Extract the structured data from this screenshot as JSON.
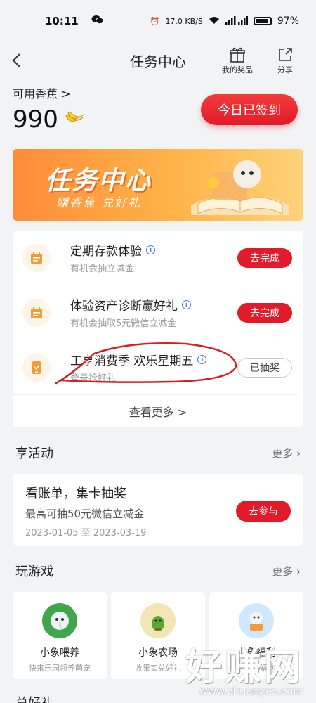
{
  "status_bar": {
    "time": "10:11",
    "speed": "17.0 KB/S",
    "battery": "97%"
  },
  "header": {
    "back_icon": "chevron-left-icon",
    "title": "任务中心",
    "prizes_label": "我的奖品",
    "share_label": "分享"
  },
  "points": {
    "label": "可用香蕉 >",
    "value": "990",
    "sign_button": "今日已签到"
  },
  "banner": {
    "title": "任务中心",
    "subtitle": "赚香蕉 兑好礼"
  },
  "tasks": [
    {
      "name": "定期存款体验",
      "sub": "有机会抽立减金",
      "action": "去完成",
      "state": "todo"
    },
    {
      "name": "体验资产诊断赢好礼",
      "sub": "有机会抽取5元微信立减金",
      "action": "去完成",
      "state": "todo"
    },
    {
      "name": "工享消费季 欢乐星期五",
      "sub": "登录抢好礼",
      "action": "已抽奖",
      "state": "done"
    }
  ],
  "tasks_more": "查看更多 >",
  "activities": {
    "title": "享活动",
    "more": "更多 ›",
    "item": {
      "title": "看账单，集卡抽奖",
      "sub": "最高可抽50元微信立减金",
      "dates": "2023-01-05 至 2023-03-19",
      "action": "去参与"
    }
  },
  "games": {
    "title": "玩游戏",
    "more": "更多 ›",
    "items": [
      {
        "name": "小象喂养",
        "sub": "快来乐园领养萌宠"
      },
      {
        "name": "小象农场",
        "sub": "收果实兑好礼"
      },
      {
        "name": "小象福利",
        "sub": "天天领福利"
      }
    ]
  },
  "next_section": "兑好礼",
  "watermark": {
    "big": "好赚网",
    "small": "www.zhuanyes.com"
  },
  "colors": {
    "accent": "#e21b2a",
    "banner": "#ff9a3c",
    "icon_orange": "#f29b38"
  }
}
